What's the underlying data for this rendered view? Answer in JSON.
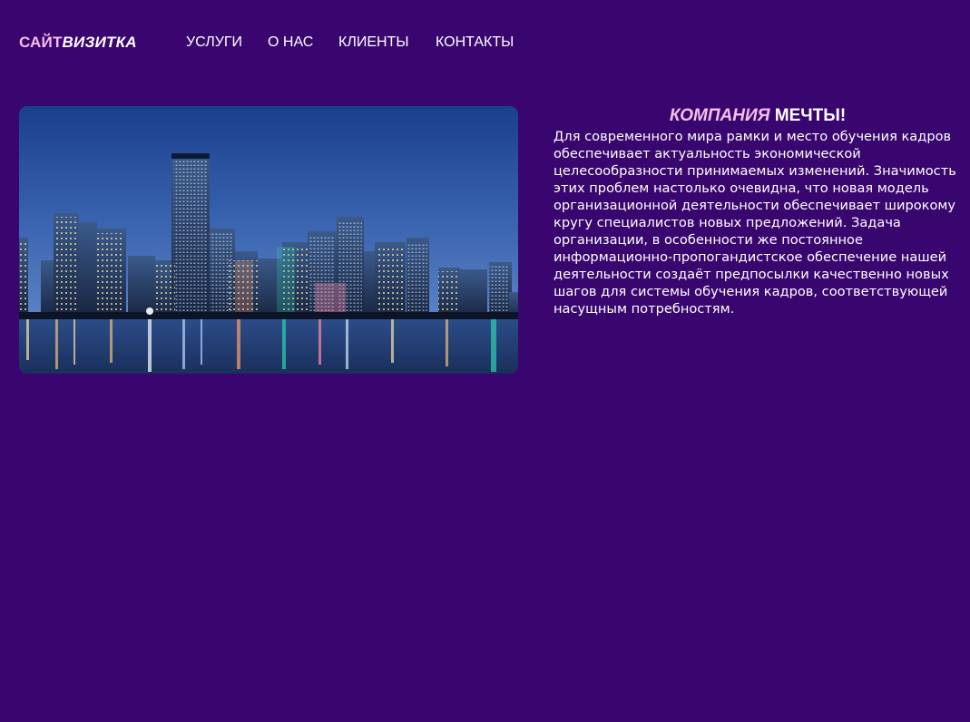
{
  "header": {
    "logo": {
      "part1": "САЙТ",
      "part2": "ВИЗИТКА"
    },
    "nav": [
      {
        "label": "УСЛУГИ"
      },
      {
        "label": "О НАС"
      },
      {
        "label": "КЛИЕНТЫ"
      },
      {
        "label": "КОНТАКТЫ"
      }
    ]
  },
  "hero": {
    "image_subject": "night-city-skyline"
  },
  "content": {
    "headline_part1": "КОМПАНИЯ",
    "headline_part2": "МЕЧТЫ!",
    "paragraph": "Для современного мира рамки и место обучения кадров обеспечивает актуальность экономической целесообразности принимаемых изменений. Значимость этих проблем настолько очевидна, что новая модель организационной деятельности обеспечивает широкому кругу специалистов новых предложений. Задача организации, в особенности же постоянное информационно-пропогандистское обеспечение нашей деятельности создаёт предпосылки качественно новых шагов для системы обучения кадров, соответствующей насущным потребностям."
  },
  "colors": {
    "background": "#390670",
    "accent_pink": "#f7bfe6",
    "text": "#ffffff"
  }
}
